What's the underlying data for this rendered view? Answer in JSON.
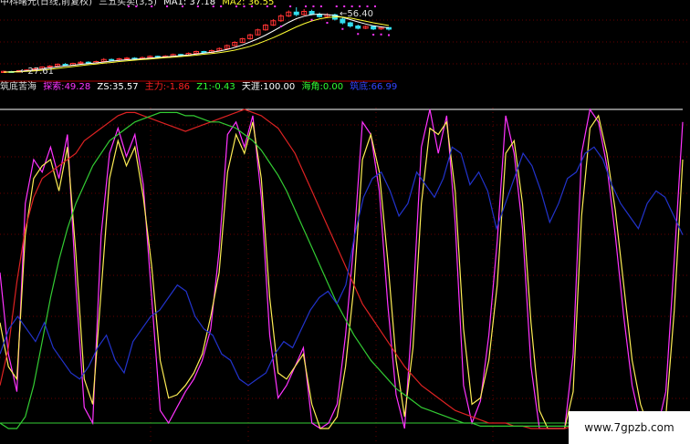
{
  "header": {
    "title": "中科曙光(日线,前复权)",
    "indicator": "三五买卖(3,5)",
    "ma1_label": "MA1:",
    "ma1_value": "37.18",
    "ma2_label": "MA2:",
    "ma2_value": "36.55"
  },
  "price_labels": {
    "high": "56.40",
    "low": "27.61"
  },
  "sub_indicator": {
    "name": "筑底苦海",
    "items": [
      {
        "label": "探索:",
        "value": "49.28",
        "color": "#ff33ff"
      },
      {
        "label": "ZS:",
        "value": "35.57",
        "color": "#ffffff"
      },
      {
        "label": "主力:",
        "value": "-1.86",
        "color": "#ff2020"
      },
      {
        "label": "Z1:",
        "value": "-0.43",
        "color": "#33ff33"
      },
      {
        "label": "天涯:",
        "value": "100.00",
        "color": "#ffffff"
      },
      {
        "label": "海角:",
        "value": "0.00",
        "color": "#33ff33"
      },
      {
        "label": "筑底:",
        "value": "66.99",
        "color": "#3344ff"
      }
    ]
  },
  "watermark": "www.7gpzb.com",
  "colors": {
    "background": "#000000",
    "up_candle": "#ff3333",
    "down_candle": "#33ddee",
    "ma1": "#ffffff",
    "ma2": "#ffff33",
    "separator": "#aa0000",
    "magenta": "#ff33ff",
    "yellow": "#ffee55",
    "red": "#dd2222",
    "green": "#33cc33",
    "blue": "#2233cc"
  },
  "chart_data": {
    "type": "line",
    "price_panel": {
      "candles": [
        [
          27.8,
          28.3,
          27.6,
          28.6
        ],
        [
          28.2,
          28.0,
          27.8,
          28.5
        ],
        [
          28.0,
          28.6,
          27.9,
          28.9
        ],
        [
          28.6,
          28.9,
          28.4,
          29.2
        ],
        [
          28.9,
          29.4,
          28.7,
          29.7
        ],
        [
          29.4,
          30.2,
          29.2,
          30.5
        ],
        [
          30.2,
          30.6,
          29.9,
          31.0
        ],
        [
          30.6,
          31.4,
          30.3,
          31.8
        ],
        [
          31.4,
          31.0,
          30.6,
          31.9
        ],
        [
          31.0,
          31.8,
          30.8,
          32.1
        ],
        [
          31.8,
          32.3,
          31.5,
          32.8
        ],
        [
          32.3,
          32.0,
          31.6,
          32.7
        ],
        [
          32.0,
          32.6,
          31.8,
          33.0
        ],
        [
          32.6,
          33.5,
          32.4,
          34.1
        ],
        [
          33.5,
          33.2,
          32.8,
          33.9
        ],
        [
          33.2,
          33.8,
          32.9,
          34.2
        ],
        [
          33.8,
          34.1,
          33.5,
          34.6
        ],
        [
          34.1,
          33.7,
          33.3,
          34.5
        ],
        [
          33.7,
          34.3,
          33.4,
          34.8
        ],
        [
          34.3,
          34.9,
          34.0,
          35.3
        ],
        [
          34.9,
          34.6,
          34.2,
          35.2
        ],
        [
          34.6,
          35.0,
          34.3,
          35.4
        ],
        [
          35.0,
          35.7,
          34.8,
          36.1
        ],
        [
          35.7,
          35.3,
          35.0,
          36.0
        ],
        [
          35.3,
          36.2,
          35.1,
          36.6
        ],
        [
          36.2,
          37.0,
          35.9,
          37.4
        ],
        [
          37.0,
          36.6,
          36.2,
          37.3
        ],
        [
          36.6,
          37.4,
          36.3,
          37.9
        ],
        [
          37.4,
          38.3,
          37.1,
          38.8
        ],
        [
          38.3,
          39.6,
          38.0,
          40.1
        ],
        [
          39.6,
          41.0,
          39.2,
          41.5
        ],
        [
          41.0,
          42.6,
          40.7,
          43.0
        ],
        [
          42.6,
          44.3,
          42.2,
          44.8
        ],
        [
          44.3,
          46.5,
          44.0,
          47.0
        ],
        [
          46.5,
          48.6,
          46.1,
          49.1
        ],
        [
          48.6,
          50.5,
          48.2,
          51.2
        ],
        [
          50.5,
          52.6,
          50.0,
          53.4
        ],
        [
          52.6,
          54.3,
          52.1,
          55.0
        ],
        [
          54.3,
          53.2,
          52.5,
          56.4
        ],
        [
          53.2,
          54.6,
          52.8,
          55.6
        ],
        [
          54.6,
          53.4,
          52.9,
          55.3
        ],
        [
          53.4,
          52.3,
          51.8,
          54.1
        ],
        [
          52.3,
          53.1,
          51.6,
          53.8
        ],
        [
          53.1,
          51.2,
          50.6,
          53.6
        ],
        [
          51.2,
          49.6,
          48.9,
          51.8
        ],
        [
          49.6,
          48.2,
          47.5,
          50.1
        ],
        [
          48.2,
          47.2,
          46.7,
          48.8
        ],
        [
          47.2,
          48.0,
          46.8,
          48.4
        ],
        [
          48.0,
          46.9,
          46.4,
          48.3
        ],
        [
          46.9,
          47.5,
          46.5,
          47.9
        ],
        [
          47.5,
          46.8,
          46.2,
          47.7
        ]
      ],
      "ma1": [
        28.0,
        28.1,
        28.3,
        28.6,
        28.9,
        29.3,
        29.8,
        30.3,
        30.7,
        31.0,
        31.4,
        31.7,
        32.0,
        32.4,
        32.8,
        33.1,
        33.4,
        33.6,
        33.8,
        34.1,
        34.4,
        34.6,
        34.9,
        35.2,
        35.5,
        35.9,
        36.3,
        36.7,
        37.2,
        37.9,
        38.8,
        39.9,
        41.2,
        42.6,
        44.2,
        46.0,
        47.9,
        49.8,
        51.4,
        52.5,
        53.2,
        53.4,
        53.2,
        52.8,
        52.0,
        51.0,
        50.0,
        49.1,
        48.3,
        47.8,
        47.4
      ],
      "ma2": [
        27.9,
        28.0,
        28.1,
        28.3,
        28.5,
        28.8,
        29.2,
        29.6,
        30.0,
        30.4,
        30.8,
        31.2,
        31.5,
        31.9,
        32.2,
        32.6,
        32.9,
        33.2,
        33.5,
        33.7,
        34.0,
        34.3,
        34.5,
        34.8,
        35.1,
        35.4,
        35.8,
        36.1,
        36.5,
        37.0,
        37.6,
        38.4,
        39.3,
        40.4,
        41.7,
        43.1,
        44.6,
        46.2,
        47.8,
        49.2,
        50.4,
        51.3,
        51.9,
        52.2,
        52.1,
        51.7,
        51.0,
        50.3,
        49.6,
        49.0,
        48.4
      ],
      "markers_top": [
        2,
        3,
        5,
        7,
        9,
        11,
        13,
        14,
        16,
        17,
        18,
        20,
        21,
        23,
        25,
        26,
        27,
        29,
        30,
        31,
        32,
        33,
        34
      ],
      "markers_bottom": [
        36,
        40,
        42,
        44,
        46,
        48,
        49,
        50
      ]
    },
    "sub_panel": {
      "ylim": [
        0,
        100
      ],
      "top_line": 100,
      "bottom_line": 0,
      "series": [
        {
          "name": "探索",
          "color": "#ff33ff",
          "values": [
            48,
            22,
            10,
            70,
            84,
            80,
            88,
            78,
            92,
            44,
            5,
            0,
            60,
            86,
            94,
            85,
            92,
            76,
            40,
            4,
            0,
            5,
            10,
            14,
            20,
            30,
            55,
            92,
            96,
            88,
            98,
            72,
            28,
            8,
            12,
            18,
            24,
            0,
            -4,
            0,
            6,
            28,
            58,
            96,
            92,
            74,
            38,
            9,
            -2,
            38,
            88,
            100,
            86,
            98,
            64,
            12,
            0,
            7,
            28,
            58,
            98,
            86,
            62,
            18,
            -6,
            -10,
            -14,
            -4,
            22,
            86,
            100,
            96,
            82,
            60,
            34,
            12,
            0,
            -8,
            -12,
            10,
            52,
            96
          ]
        },
        {
          "name": "ZS",
          "color": "#ffee55",
          "values": [
            32,
            18,
            14,
            60,
            78,
            82,
            84,
            74,
            88,
            54,
            14,
            6,
            42,
            78,
            90,
            82,
            88,
            72,
            50,
            20,
            8,
            9,
            12,
            16,
            22,
            34,
            48,
            80,
            92,
            86,
            96,
            78,
            40,
            16,
            14,
            18,
            22,
            6,
            -2,
            -4,
            2,
            18,
            44,
            84,
            92,
            80,
            52,
            20,
            2,
            24,
            70,
            94,
            92,
            96,
            74,
            30,
            6,
            8,
            20,
            44,
            86,
            90,
            70,
            32,
            4,
            -4,
            -10,
            -8,
            10,
            66,
            94,
            98,
            86,
            68,
            44,
            20,
            6,
            -4,
            -10,
            2,
            36,
            84
          ]
        },
        {
          "name": "主力",
          "color": "#dd2222",
          "values": [
            12,
            24,
            45,
            62,
            72,
            78,
            80,
            82,
            84,
            86,
            90,
            92,
            94,
            96,
            98,
            99,
            99,
            98,
            97,
            96,
            95,
            94,
            93,
            94,
            95,
            96,
            97,
            98,
            99,
            100,
            99,
            98,
            96,
            94,
            90,
            86,
            80,
            74,
            68,
            62,
            56,
            50,
            44,
            38,
            34,
            30,
            26,
            22,
            18,
            15,
            12,
            10,
            8,
            6,
            4,
            3,
            2,
            1,
            0,
            0,
            0,
            -1,
            -1,
            -2,
            -2,
            -2,
            -2,
            -2,
            -1,
            -2,
            -2,
            -2,
            -2,
            -2,
            -2,
            -2,
            -2,
            -2,
            -2,
            -2,
            -2,
            -2
          ]
        },
        {
          "name": "Z1",
          "color": "#33cc33",
          "values": [
            0,
            -4,
            -8,
            2,
            12,
            26,
            40,
            52,
            62,
            70,
            76,
            82,
            86,
            90,
            92,
            94,
            96,
            97,
            98,
            99,
            99,
            99,
            98,
            98,
            97,
            96,
            96,
            95,
            94,
            92,
            90,
            87,
            83,
            79,
            74,
            68,
            62,
            56,
            50,
            44,
            38,
            33,
            28,
            24,
            20,
            17,
            14,
            11,
            9,
            7,
            5,
            4,
            3,
            2,
            1,
            0,
            0,
            -1,
            -1,
            -1,
            -1,
            -1,
            -1,
            -1,
            -1,
            -1,
            -1,
            -1,
            -1,
            -1,
            -1,
            -1,
            -1,
            -1,
            -1,
            -1,
            -1,
            -1,
            -1,
            -1,
            -1,
            -1
          ]
        },
        {
          "name": "筑底",
          "color": "#2233cc",
          "values": [
            22,
            30,
            34,
            30,
            26,
            32,
            24,
            20,
            16,
            14,
            18,
            24,
            28,
            20,
            16,
            26,
            30,
            34,
            36,
            40,
            44,
            42,
            34,
            30,
            28,
            22,
            20,
            14,
            12,
            14,
            16,
            22,
            26,
            24,
            30,
            36,
            40,
            42,
            38,
            44,
            60,
            72,
            78,
            80,
            74,
            66,
            70,
            80,
            76,
            72,
            78,
            88,
            86,
            76,
            80,
            74,
            62,
            70,
            78,
            86,
            82,
            74,
            64,
            70,
            78,
            80,
            86,
            88,
            84,
            76,
            70,
            66,
            62,
            70,
            74,
            72,
            66,
            60
          ]
        }
      ]
    }
  }
}
